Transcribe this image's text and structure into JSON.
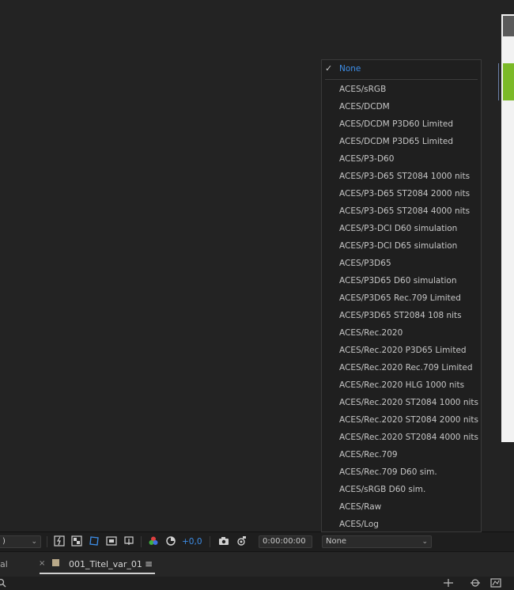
{
  "toolbar": {
    "left_select_value": ")",
    "exposure_value": "+0,0",
    "timecode": "0:00:00:00",
    "view_select_value": "None",
    "icons": [
      "fast-preview-icon",
      "transparency-grid-icon",
      "mask-guide-icon",
      "toggle-region-icon",
      "3d-view-icon",
      "color-channel-icon",
      "reset-exposure-icon",
      "camera-snapshot-icon",
      "show-snapshot-icon"
    ]
  },
  "dropdown": {
    "selected": "None",
    "items": [
      "None",
      "ACES/sRGB",
      "ACES/DCDM",
      "ACES/DCDM P3D60 Limited",
      "ACES/DCDM P3D65 Limited",
      "ACES/P3-D60",
      "ACES/P3-D65 ST2084 1000 nits",
      "ACES/P3-D65 ST2084 2000 nits",
      "ACES/P3-D65 ST2084 4000 nits",
      "ACES/P3-DCI D60 simulation",
      "ACES/P3-DCI D65 simulation",
      "ACES/P3D65",
      "ACES/P3D65 D60 simulation",
      "ACES/P3D65 Rec.709 Limited",
      "ACES/P3D65 ST2084 108 nits",
      "ACES/Rec.2020",
      "ACES/Rec.2020 P3D65 Limited",
      "ACES/Rec.2020 Rec.709 Limited",
      "ACES/Rec.2020 HLG 1000 nits",
      "ACES/Rec.2020 ST2084 1000 nits",
      "ACES/Rec.2020 ST2084 2000 nits",
      "ACES/Rec.2020 ST2084 4000 nits",
      "ACES/Rec.709",
      "ACES/Rec.709 D60 sim.",
      "ACES/sRGB D60 sim.",
      "ACES/Raw",
      "ACES/Log"
    ]
  },
  "tabs": {
    "left_partial": "al",
    "close_glyph": "×",
    "active_title": "001_Titel_var_01",
    "menu_glyph": "≡",
    "swatch_color": "#b9a989"
  },
  "colors": {
    "accent_blue": "#3d8ee8",
    "comp_green": "#7bb927"
  }
}
